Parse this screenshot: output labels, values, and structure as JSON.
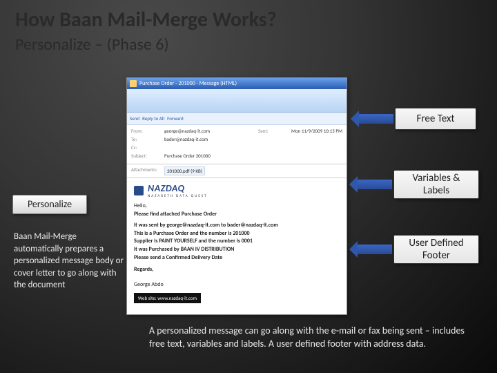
{
  "title": "How Baan Mail-Merge Works?",
  "subtitle": "Personalize – (Phase 6)",
  "callouts": {
    "free_text": "Free Text",
    "variables_labels": "Variables & Labels",
    "user_defined_footer": "User Defined Footer",
    "personalize": "Personalize"
  },
  "left_text": "Baan Mail-Merge automatically prepares a personalized message body or cover letter to go along with the document",
  "bottom_text": "A personalized message can go along with the e-mail or fax being sent – includes free text, variables and labels. A user defined footer with address data.",
  "screenshot": {
    "window_title": "Purchase Order - 201000 - Message (HTML)",
    "toolbar": {
      "send": "Send",
      "reply": "Reply to All",
      "forward": "Forward"
    },
    "hdr": {
      "from_lbl": "From:",
      "from_val": "george@nazdaq-it.com",
      "to_lbl": "To:",
      "to_val": "bader@nazdaq-it.com",
      "cc_lbl": "Cc:",
      "cc_val": "",
      "subj_lbl": "Subject:",
      "subj_val": "Purchase Order 201000",
      "sent_lbl": "Sent:",
      "sent_val": "Mon 11/9/2009 10:15 PM",
      "attach_lbl": "Attachments:",
      "attach_val": "201000.pdf (9 KB)"
    },
    "logo_text": "NAZDAQ",
    "logo_sub": "NAZARETH DATA QUEST",
    "msg": {
      "hello": "Hello,",
      "line1": "Please find attached Purchase Order",
      "line2": "It was sent by george@nazdaq-it.com to bader@nazdaq-it.com",
      "line3": "This is a Purchase Order and the number is 201000",
      "line4": "Supplier is PAINT YOURSELF and the number is 0001",
      "line5": "It was Purchased by BAAN IV DISTRIBUTION",
      "line6": "Please send a Confirmed Delivery Date",
      "regards": "Regards,",
      "signature": "George Abdo",
      "footer": "Web site: www.nazdaq-it.com"
    }
  }
}
